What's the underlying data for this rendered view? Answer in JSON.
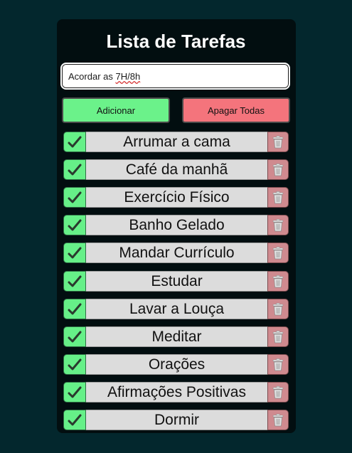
{
  "app": {
    "title": "Lista de Tarefas"
  },
  "input": {
    "value_prefix": "Acordar as ",
    "value_flagged": "7H/8h"
  },
  "buttons": {
    "add_label": "Adicionar",
    "clear_label": "Apagar Todas"
  },
  "tasks": [
    {
      "label": "Arrumar a cama"
    },
    {
      "label": "Café da manhã"
    },
    {
      "label": "Exercício Físico"
    },
    {
      "label": "Banho Gelado"
    },
    {
      "label": "Mandar Currículo"
    },
    {
      "label": "Estudar"
    },
    {
      "label": "Lavar a Louça"
    },
    {
      "label": "Meditar"
    },
    {
      "label": "Orações"
    },
    {
      "label": "Afirmações Positivas"
    },
    {
      "label": "Dormir"
    }
  ],
  "icons": {
    "complete": "check-mark-icon",
    "delete": "trash-can-icon"
  },
  "colors": {
    "background": "#03272d",
    "card": "#020e10",
    "add_button": "#6bf28a",
    "clear_button": "#f4747c",
    "check_box": "#66f088",
    "delete_box": "#cf8a8f",
    "task_bar": "#dcdcdc"
  }
}
